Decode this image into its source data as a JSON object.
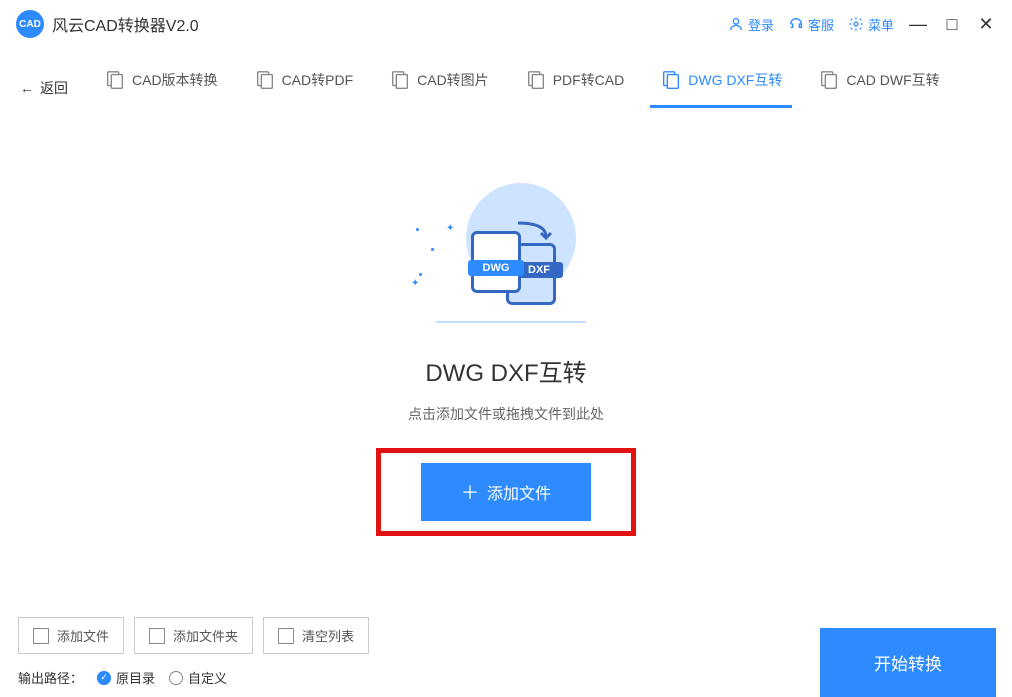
{
  "app": {
    "title": "风云CAD转换器V2.0",
    "logo_text": "CAD"
  },
  "header": {
    "login": "登录",
    "support": "客服",
    "menu": "菜单"
  },
  "nav": {
    "back": "返回",
    "items": [
      {
        "label": "CAD版本转换"
      },
      {
        "label": "CAD转PDF"
      },
      {
        "label": "CAD转图片"
      },
      {
        "label": "PDF转CAD"
      },
      {
        "label": "DWG DXF互转",
        "active": true
      },
      {
        "label": "CAD DWF互转"
      }
    ]
  },
  "main": {
    "dwg": "DWG",
    "dxf": "DXF",
    "title": "DWG DXF互转",
    "subtitle": "点击添加文件或拖拽文件到此处",
    "add_button": "添加文件"
  },
  "bottom": {
    "add_file": "添加文件",
    "add_folder": "添加文件夹",
    "clear_list": "清空列表",
    "start": "开始转换",
    "output_label": "输出路径：",
    "orig_dir": "原目录",
    "custom": "自定义"
  }
}
